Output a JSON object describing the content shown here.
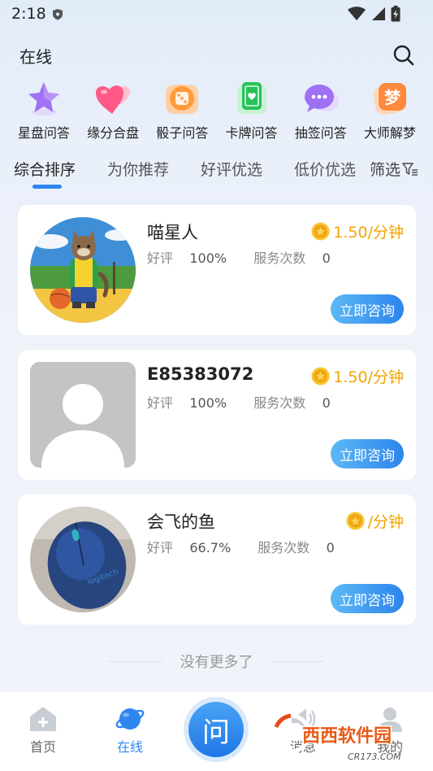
{
  "status_bar": {
    "time": "2:18"
  },
  "header": {
    "title": "在线",
    "search_icon": "search-icon"
  },
  "categories": [
    {
      "label": "星盘问答",
      "icon": "star-icon",
      "color": "#9b6cf2"
    },
    {
      "label": "缘分合盘",
      "icon": "heart-icon",
      "color": "#ff5f8a"
    },
    {
      "label": "骰子问答",
      "icon": "dice-icon",
      "color": "#ff9c3a"
    },
    {
      "label": "卡牌问答",
      "icon": "card-icon",
      "color": "#2fc45d"
    },
    {
      "label": "抽签问答",
      "icon": "chat-bubble-icon",
      "color": "#9b6cf2"
    },
    {
      "label": "大师解梦",
      "icon": "dream-icon",
      "color": "#ff8a3d",
      "glyph": "梦"
    }
  ],
  "sort_tabs": [
    {
      "label": "综合排序",
      "active": true
    },
    {
      "label": "为你推荐",
      "active": false
    },
    {
      "label": "好评优选",
      "active": false
    },
    {
      "label": "低价优选",
      "active": false
    }
  ],
  "filter": {
    "label": "筛选",
    "icon": "filter-icon"
  },
  "consultants": [
    {
      "name": "喵星人",
      "price": "1.50/分钟",
      "rating_label": "好评",
      "rating": "100%",
      "service_label": "服务次数",
      "service_count": "0",
      "button": "立即咨询",
      "avatar": "cat-avatar"
    },
    {
      "name": "E85383072",
      "price": "1.50/分钟",
      "rating_label": "好评",
      "rating": "100%",
      "service_label": "服务次数",
      "service_count": "0",
      "button": "立即咨询",
      "avatar": "default-avatar"
    },
    {
      "name": "会飞的鱼",
      "price": "/分钟",
      "rating_label": "好评",
      "rating": "66.7%",
      "service_label": "服务次数",
      "service_count": "0",
      "button": "立即咨询",
      "avatar": "mouse-avatar"
    }
  ],
  "end_note": "没有更多了",
  "bottom_nav": [
    {
      "label": "首页",
      "icon": "home-icon",
      "active": false
    },
    {
      "label": "在线",
      "icon": "planet-icon",
      "active": true
    },
    {
      "label": "问",
      "icon": "ask-button"
    },
    {
      "label": "消息",
      "icon": "speaker-icon",
      "active": false
    },
    {
      "label": "我的",
      "icon": "user-icon",
      "active": false
    }
  ],
  "watermark": {
    "brand": "西西软件园",
    "site": "CR173.COM"
  },
  "colors": {
    "accent": "#2e86f0",
    "price": "#f0a400",
    "card_bg": "#ffffff"
  }
}
